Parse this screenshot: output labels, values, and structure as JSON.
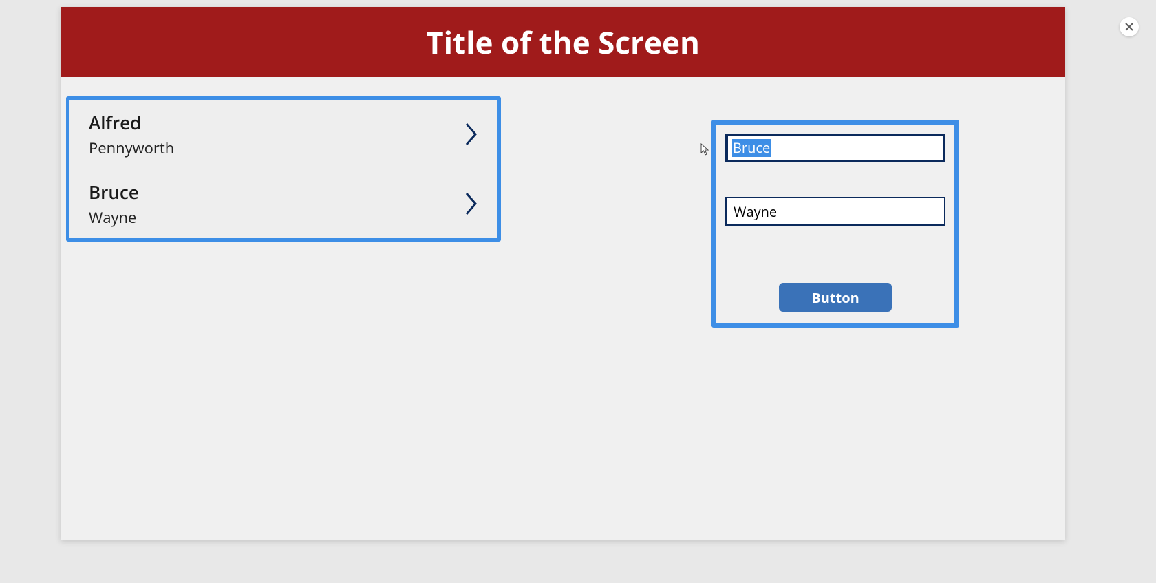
{
  "header": {
    "title": "Title of the Screen"
  },
  "list": {
    "items": [
      {
        "primary": "Alfred",
        "secondary": "Pennyworth"
      },
      {
        "primary": "Bruce",
        "secondary": "Wayne"
      }
    ]
  },
  "form": {
    "first_name_value": "Bruce",
    "last_name_value": "Wayne",
    "button_label": "Button"
  },
  "icons": {
    "chevron": "chevron-right-icon",
    "close": "close-icon",
    "cursor": "cursor-icon"
  },
  "colors": {
    "header_bg": "#a01b1b",
    "highlight_blue": "#3d8ee6",
    "dark_navy": "#0b2a5c",
    "button_bg": "#3a72b8"
  }
}
